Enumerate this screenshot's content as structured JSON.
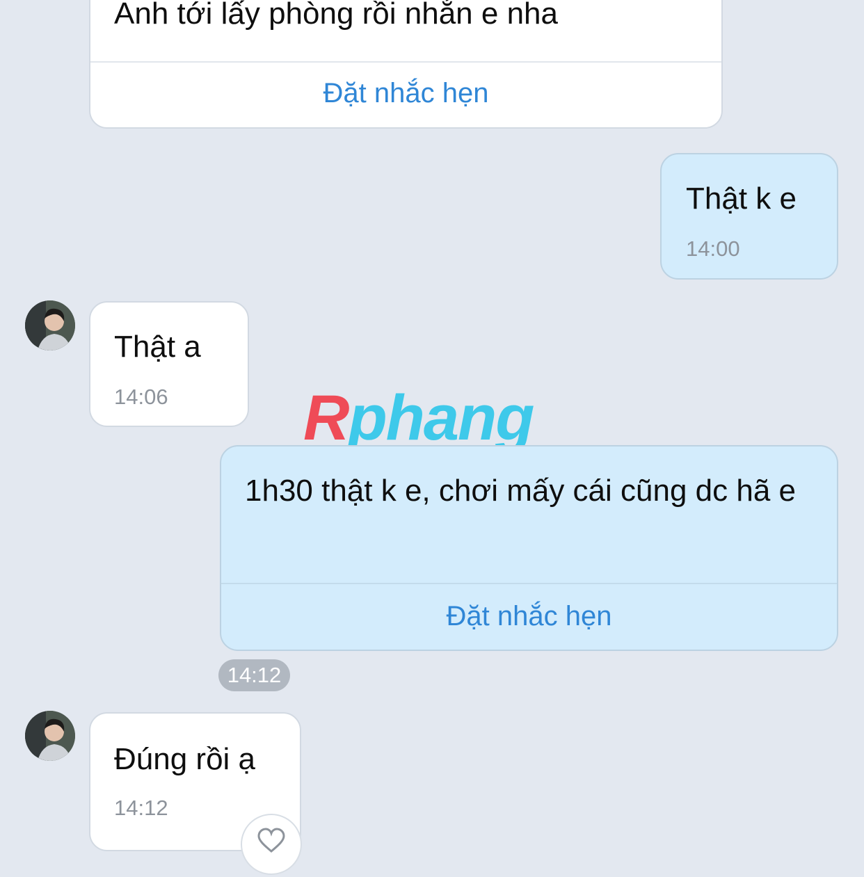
{
  "messages": [
    {
      "text": "Anh tới lấy phòng rồi nhắn e nha",
      "action": "Đặt nhắc hẹn"
    },
    {
      "text": "Thật k e",
      "time": "14:00"
    },
    {
      "text": "Thật a",
      "time": "14:06"
    },
    {
      "text": "1h30 thật k e, chơi mấy cái cũng dc hã e",
      "action": "Đặt nhắc hẹn"
    },
    {
      "text": "Đúng rồi ạ",
      "time": "14:12"
    }
  ],
  "time_pill": "14:12",
  "watermark": {
    "part1": "R",
    "part2": "phang"
  },
  "icons": {
    "reaction": "heart-icon",
    "avatar": "avatar"
  },
  "colors": {
    "background": "#e3e8f0",
    "outgoing_bubble": "#d3ecfc",
    "incoming_bubble": "#ffffff",
    "link": "#2f86d6"
  }
}
